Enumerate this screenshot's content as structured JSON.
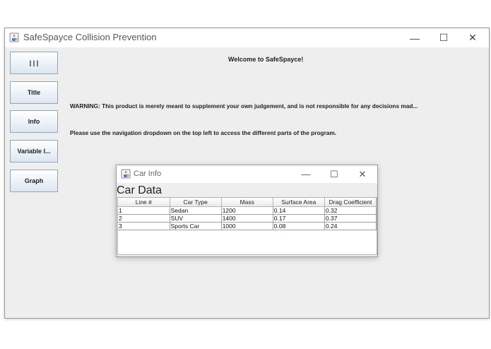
{
  "window": {
    "title": "SafeSpayce Collision Prevention",
    "minimize": "—",
    "maximize": "☐",
    "close": "✕"
  },
  "nav": {
    "buttons": [
      {
        "label": "| | |"
      },
      {
        "label": "Title"
      },
      {
        "label": "Info"
      },
      {
        "label": "Variable I..."
      },
      {
        "label": "Graph"
      }
    ]
  },
  "main": {
    "welcome": "Welcome to SafeSpayce!",
    "warning": "WARNING: This product is merely meant to supplement your own judgement, and is not responsible for any decisions mad...",
    "nav_help": "Please use the navigation dropdown on the top left to access the different parts of the program."
  },
  "dialog": {
    "title": "Car Info",
    "heading": "Car Data",
    "minimize": "—",
    "maximize": "☐",
    "close": "✕",
    "columns": [
      "Line #",
      "Car Type",
      "Mass",
      "Surface Area",
      "Drag Coefficient"
    ],
    "rows": [
      [
        "1",
        "Sedan",
        "1200",
        "0.14",
        "0.32"
      ],
      [
        "2",
        "SUV",
        "1400",
        "0.17",
        "0.37"
      ],
      [
        "3",
        "Sports Car",
        "1000",
        "0.08",
        "0.24"
      ]
    ]
  }
}
